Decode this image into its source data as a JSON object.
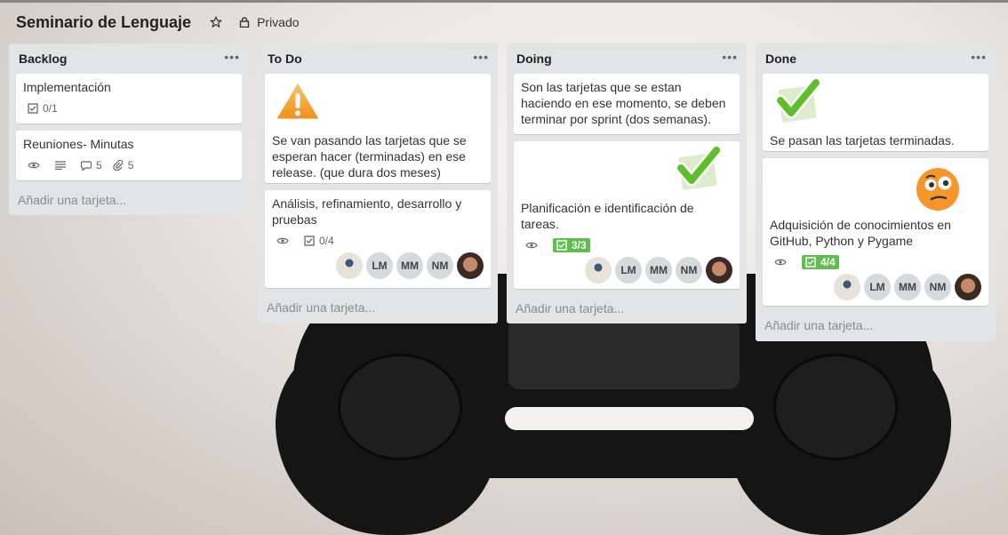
{
  "board": {
    "title": "Seminario de Lenguaje",
    "privacy": "Privado"
  },
  "lists": [
    {
      "title": "Backlog",
      "add_label": "Añadir una tarjeta...",
      "cards": [
        {
          "text": "Implementación",
          "checklist": "0/1"
        },
        {
          "text": "Reuniones- Minutas",
          "comments": "5",
          "attachments": "5"
        }
      ]
    },
    {
      "title": "To Do",
      "add_label": "Añadir una tarjeta...",
      "cards": [
        {
          "text": "Se van pasando las tarjetas que se esperan hacer (terminadas) en ese release. (que dura dos meses)",
          "cover_icon": "warning-icon"
        },
        {
          "text": "Análisis, refinamiento, desarrollo y pruebas",
          "checklist": "0/4",
          "members": [
            "LM",
            "MM",
            "NM"
          ]
        }
      ]
    },
    {
      "title": "Doing",
      "add_label": "Añadir una tarjeta...",
      "cards": [
        {
          "text": "Son las tarjetas que se estan haciendo en ese momento, se deben terminar por sprint (dos semanas)."
        },
        {
          "text": "Planificación e identificación de tareas.",
          "checklist": "3/3",
          "cover_icon": "checkmark-icon",
          "members": [
            "LM",
            "MM",
            "NM"
          ]
        }
      ]
    },
    {
      "title": "Done",
      "add_label": "Añadir una tarjeta...",
      "cards": [
        {
          "text": "Se pasan las tarjetas terminadas.",
          "cover_icon": "checkmark-icon"
        },
        {
          "text": "Adquisición de conocimientos en GitHub, Python y Pygame",
          "checklist": "4/4",
          "cover_icon": "emoji-face-icon",
          "members": [
            "LM",
            "MM",
            "NM"
          ]
        }
      ]
    }
  ],
  "colors": {
    "list_bg": "#e2e4e6",
    "badge_complete": "#61bd4f",
    "checkmark": "#5fbf28",
    "warning": "#f5a623"
  }
}
